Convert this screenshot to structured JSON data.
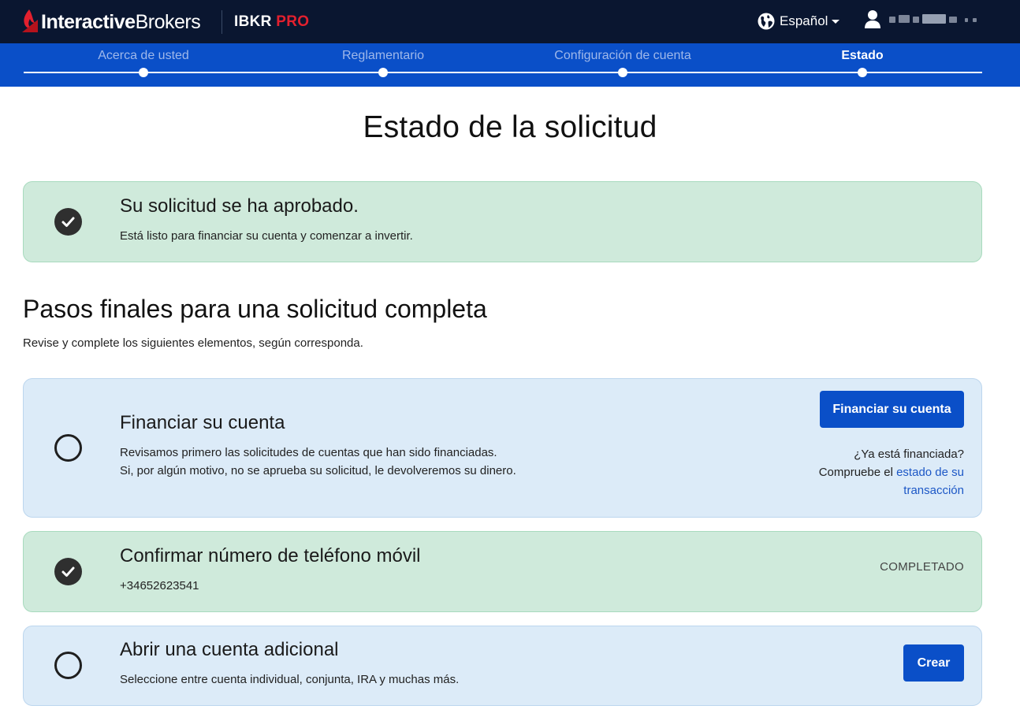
{
  "header": {
    "brand_regular": "Interactive",
    "brand_suffix": "Brokers",
    "product_name": "IBKR",
    "product_tier": "PRO",
    "language_label": "Español",
    "icons": {
      "logo": "ib-flame-logo",
      "language": "globe-icon",
      "language_caret": "caret-down-icon",
      "user": "user-icon"
    },
    "colors": {
      "background": "#0a1630",
      "accent_red": "#e3202e"
    }
  },
  "stepper": {
    "steps": [
      {
        "label": "Acerca de usted",
        "active": false
      },
      {
        "label": "Reglamentario",
        "active": false
      },
      {
        "label": "Configuración de cuenta",
        "active": false
      },
      {
        "label": "Estado",
        "active": true
      }
    ],
    "color": "#0a4fc8"
  },
  "main": {
    "title": "Estado de la solicitud",
    "approval": {
      "title": "Su solicitud se ha aprobado.",
      "description": "Está listo para financiar su cuenta y comenzar a invertir.",
      "icon": "check-circle-icon"
    },
    "final_steps": {
      "title": "Pasos finales para una solicitud completa",
      "subtitle": "Revise y complete los siguientes elementos, según corresponda."
    },
    "tasks": {
      "fund": {
        "title": "Financiar su cuenta",
        "description_line1": "Revisamos primero las solicitudes de cuentas que han sido financiadas.",
        "description_line2": "Si, por algún motivo, no se aprueba su solicitud, le devolveremos su dinero.",
        "button_label": "Financiar su cuenta",
        "already_funded": "¿Ya está financiada?",
        "check_prefix": "Compruebe el",
        "check_link_line1": "estado de su",
        "check_link_line2": "transacción",
        "icon": "empty-circle-icon",
        "completed": false
      },
      "phone": {
        "title": "Confirmar número de teléfono móvil",
        "phone_number": "+34652623541",
        "status": "COMPLETADO",
        "icon": "check-circle-icon",
        "completed": true
      },
      "additional": {
        "title": "Abrir una cuenta adicional",
        "description": "Seleccione entre cuenta individual, conjunta, IRA y muchas más.",
        "button_label": "Crear",
        "icon": "empty-circle-icon",
        "completed": false
      }
    },
    "colors": {
      "success_bg": "#cfeadb",
      "info_bg": "#dcebf8",
      "primary_button": "#0a4fc8",
      "link": "#1c57c6"
    }
  }
}
